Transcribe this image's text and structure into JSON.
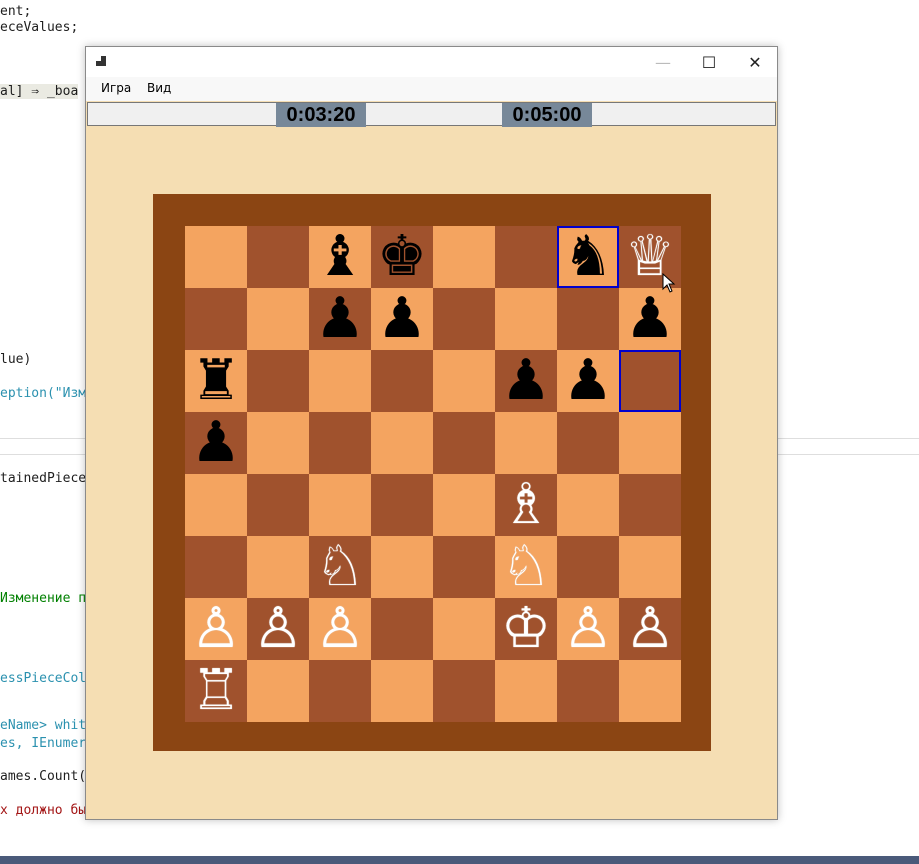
{
  "background_code": [
    {
      "text": "ent;"
    },
    {
      "text": "eceValues;"
    },
    {
      "text": "al] ⇒ _boa"
    },
    {
      "text": "lue)"
    },
    {
      "text": "eption(\"Изм"
    },
    {
      "text": "tainedPiece"
    },
    {
      "text": "Изменение п"
    },
    {
      "text": "essPieceCol"
    },
    {
      "text": "eName> whit"
    },
    {
      "text": "es, IEnumer"
    },
    {
      "text": "ames.Count("
    },
    {
      "text": "х должно бы"
    }
  ],
  "window": {
    "controls": {
      "minimize": "—",
      "maximize": "☐",
      "close": "✕"
    },
    "menu": [
      "Игра",
      "Вид"
    ]
  },
  "timers": {
    "black": "0:03:20",
    "white": "0:05:00"
  },
  "board": {
    "colors": {
      "light": "#f4a460",
      "dark": "#a0522d",
      "frame": "#8b4513",
      "selection": "#0000cd"
    },
    "rows": [
      [
        "",
        "",
        "♝",
        "♚",
        "",
        "",
        "♞",
        "♕"
      ],
      [
        "",
        "",
        "♟",
        "♟",
        "",
        "",
        "",
        "♟"
      ],
      [
        "♜",
        "",
        "",
        "",
        "",
        "♟",
        "♟",
        ""
      ],
      [
        "♟",
        "",
        "",
        "",
        "",
        "",
        "",
        ""
      ],
      [
        "",
        "",
        "",
        "",
        "",
        "♗",
        "",
        ""
      ],
      [
        "",
        "",
        "♘",
        "",
        "",
        "♘",
        "",
        ""
      ],
      [
        "♙",
        "♙",
        "♙",
        "",
        "",
        "♔",
        "♙",
        "♙"
      ],
      [
        "♖",
        "",
        "",
        "",
        "",
        "",
        "",
        ""
      ]
    ],
    "piece_colors": [
      [
        "",
        "",
        "b",
        "b",
        "",
        "",
        "b",
        "w"
      ],
      [
        "",
        "",
        "b",
        "b",
        "",
        "",
        "",
        "b"
      ],
      [
        "b",
        "",
        "",
        "",
        "",
        "b",
        "b",
        ""
      ],
      [
        "b",
        "",
        "",
        "",
        "",
        "",
        "",
        ""
      ],
      [
        "",
        "",
        "",
        "",
        "",
        "w",
        "",
        ""
      ],
      [
        "",
        "",
        "w",
        "",
        "",
        "w",
        "",
        ""
      ],
      [
        "w",
        "w",
        "w",
        "",
        "",
        "w",
        "w",
        "w"
      ],
      [
        "w",
        "",
        "",
        "",
        "",
        "",
        "",
        ""
      ]
    ],
    "selected_squares": [
      [
        0,
        6
      ],
      [
        2,
        7
      ]
    ]
  }
}
